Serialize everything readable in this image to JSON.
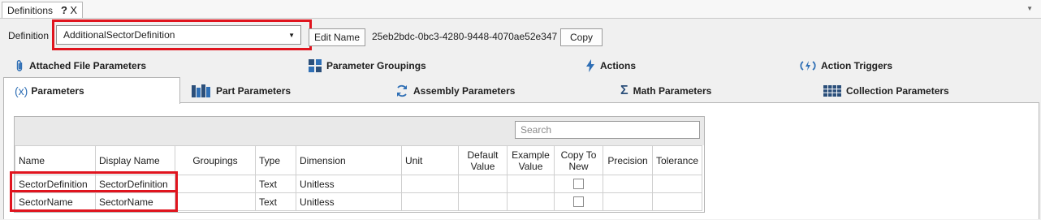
{
  "window": {
    "tab_title": "Definitions",
    "help": "?",
    "close": "X"
  },
  "definition": {
    "label": "Definition",
    "selected": "AdditionalSectorDefinition",
    "edit_button": "Edit Name",
    "guid": "25eb2bdc-0bc3-4280-9448-4070ae52e347",
    "copy_button": "Copy"
  },
  "top_tabs": [
    {
      "label": "Attached File Parameters",
      "icon": "paperclip-icon"
    },
    {
      "label": "Parameter Groupings",
      "icon": "grid-blocks-icon"
    },
    {
      "label": "Actions",
      "icon": "lightning-icon"
    },
    {
      "label": "Action Triggers",
      "icon": "trigger-icon"
    }
  ],
  "main_tabs": [
    {
      "label": "Parameters",
      "icon_text": "(x)",
      "active": true
    },
    {
      "label": "Part Parameters",
      "icon": "parts-icon"
    },
    {
      "label": "Assembly Parameters",
      "icon": "cycle-icon"
    },
    {
      "label": "Math Parameters",
      "icon_text": "Σ"
    },
    {
      "label": "Collection Parameters",
      "icon": "collection-grid-icon"
    }
  ],
  "grid": {
    "search_placeholder": "Search",
    "columns": [
      "Name",
      "Display Name",
      "Groupings",
      "Type",
      "Dimension",
      "Unit",
      "Default Value",
      "Example Value",
      "Copy To New",
      "Precision",
      "Tolerance"
    ],
    "rows": [
      {
        "name": "SectorDefinition",
        "display_name": "SectorDefinition",
        "groupings": "",
        "type": "Text",
        "dimension": "Unitless",
        "unit": "",
        "default": "",
        "example": "",
        "copy_to_new": false,
        "precision": "",
        "tolerance": ""
      },
      {
        "name": "SectorName",
        "display_name": "SectorName",
        "groupings": "",
        "type": "Text",
        "dimension": "Unitless",
        "unit": "",
        "default": "",
        "example": "",
        "copy_to_new": false,
        "precision": "",
        "tolerance": ""
      }
    ]
  },
  "colors": {
    "highlight": "#e0141e",
    "icon_blue": "#2f6fb5",
    "icon_dark": "#2b4f7a"
  }
}
